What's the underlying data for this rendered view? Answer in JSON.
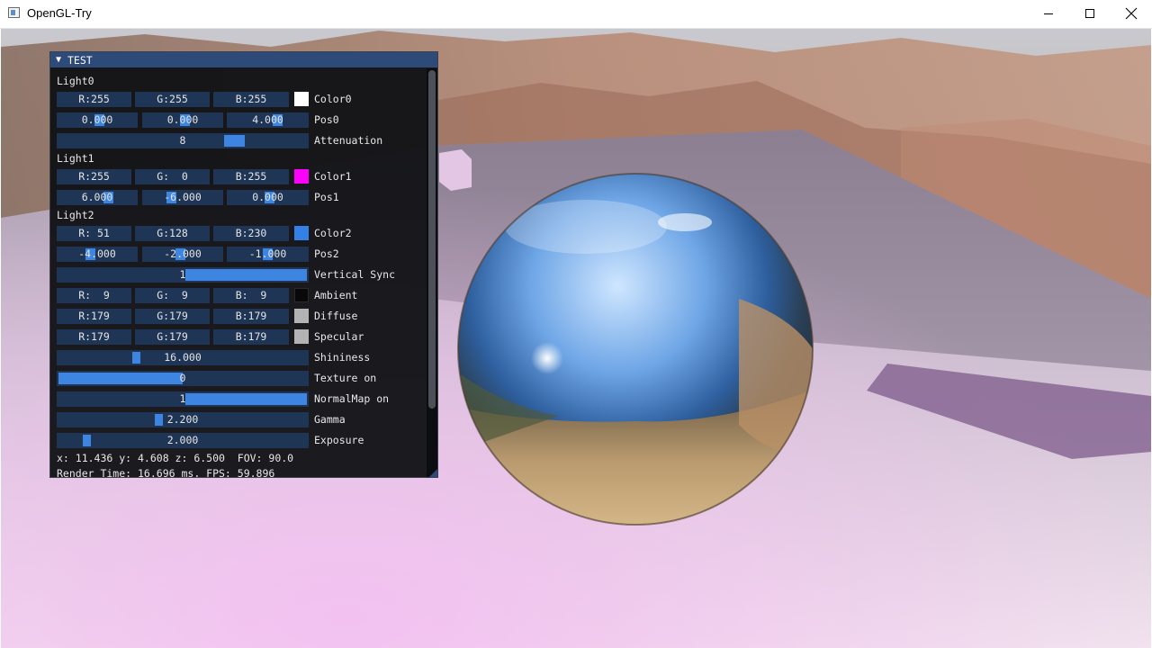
{
  "window": {
    "title": "OpenGL-Try"
  },
  "panel": {
    "title": "TEST",
    "light0": {
      "header": "Light0",
      "color": {
        "r": "R:255",
        "g": "G:255",
        "b": "B:255",
        "swatch": "#ffffff",
        "label": "Color0"
      },
      "pos": {
        "x": "0.000",
        "y": "0.000",
        "z": "4.000",
        "label": "Pos0"
      },
      "attenuation": {
        "value": "8",
        "label": "Attenuation"
      }
    },
    "light1": {
      "header": "Light1",
      "color": {
        "r": "R:255",
        "g": "G:  0",
        "b": "B:255",
        "swatch": "#ff00ff",
        "label": "Color1"
      },
      "pos": {
        "x": "6.000",
        "y": "-6.000",
        "z": "0.000",
        "label": "Pos1"
      }
    },
    "light2": {
      "header": "Light2",
      "color": {
        "r": "R: 51",
        "g": "G:128",
        "b": "B:230",
        "swatch": "#3380e6",
        "label": "Color2"
      },
      "pos": {
        "x": "-4.000",
        "y": "-2.000",
        "z": "-1.000",
        "label": "Pos2"
      }
    },
    "vsync": {
      "value": "1",
      "label": "Vertical Sync"
    },
    "ambient": {
      "r": "R:  9",
      "g": "G:  9",
      "b": "B:  9",
      "swatch": "#090909",
      "label": "Ambient"
    },
    "diffuse": {
      "r": "R:179",
      "g": "G:179",
      "b": "B:179",
      "swatch": "#b3b3b3",
      "label": "Diffuse"
    },
    "specular": {
      "r": "R:179",
      "g": "G:179",
      "b": "B:179",
      "swatch": "#b3b3b3",
      "label": "Specular"
    },
    "shininess": {
      "value": "16.000",
      "label": "Shininess"
    },
    "texture": {
      "value": "0",
      "label": "Texture on"
    },
    "normalmap": {
      "value": "1",
      "label": "NormalMap on"
    },
    "gamma": {
      "value": "2.200",
      "label": "Gamma"
    },
    "exposure": {
      "value": "2.000",
      "label": "Exposure"
    },
    "status": {
      "camera": "x: 11.436 y: 4.608 z: 6.500  FOV: 90.0",
      "render": "Render Time: 16.696 ms, FPS: 59.896"
    }
  },
  "colors": {
    "accent": "#3d85e0",
    "field_bg": "#1f3556",
    "header_bg": "#2d4a78"
  }
}
